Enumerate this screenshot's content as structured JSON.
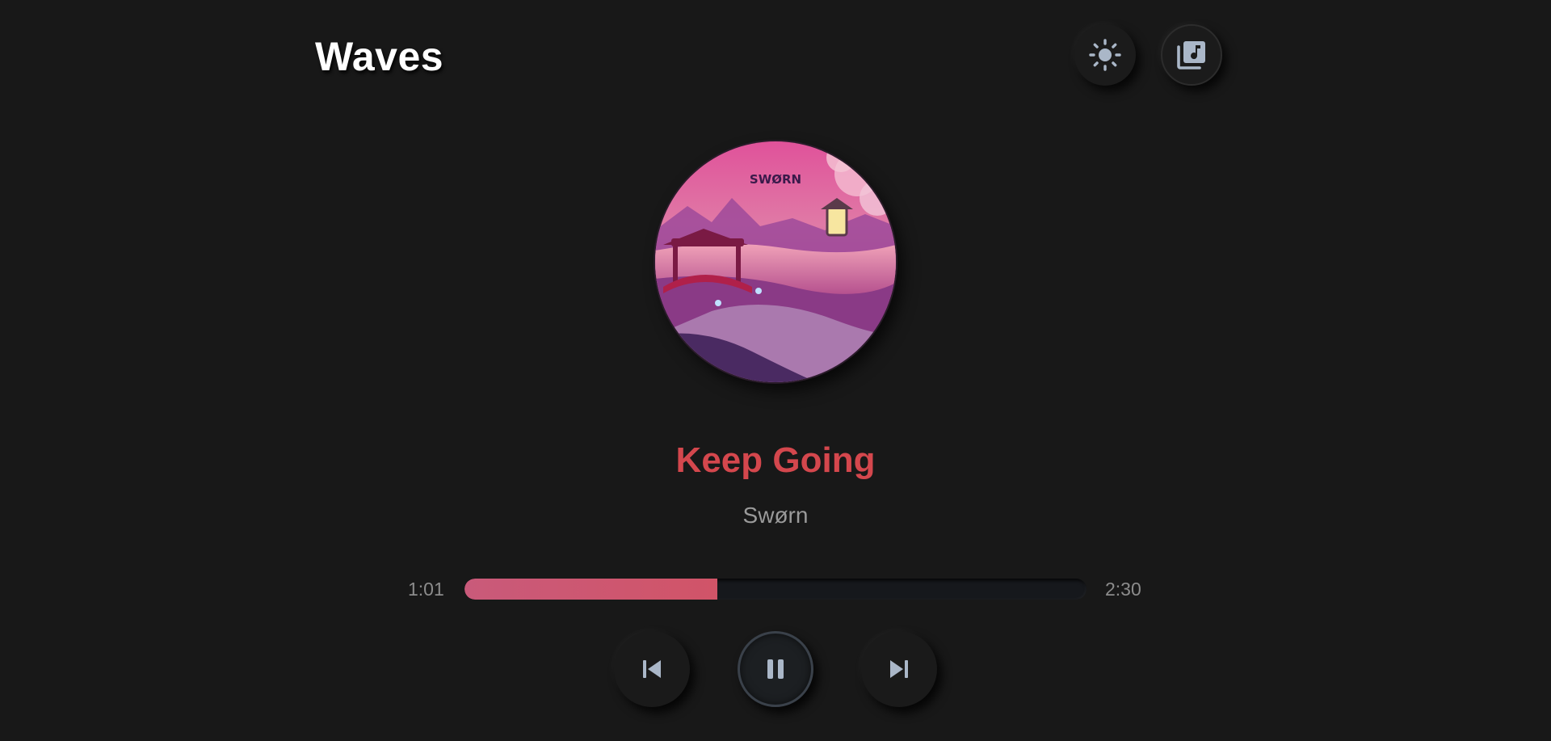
{
  "app": {
    "title": "Waves"
  },
  "header": {
    "theme_button_icon": "sun-icon",
    "library_button_icon": "music-library-icon"
  },
  "track": {
    "cover_art_text": "SWØRN",
    "title": "Keep Going",
    "artist": "Swørn"
  },
  "progress": {
    "current_time": "1:01",
    "total_time": "2:30",
    "fraction": 0.407
  },
  "controls": {
    "prev_icon": "skip-previous-icon",
    "play_pause_icon": "pause-icon",
    "next_icon": "skip-next-icon"
  },
  "colors": {
    "background": "#181818",
    "accent": "#d4474d",
    "progress_fill": "#d15468",
    "icon": "#aab7c8"
  }
}
